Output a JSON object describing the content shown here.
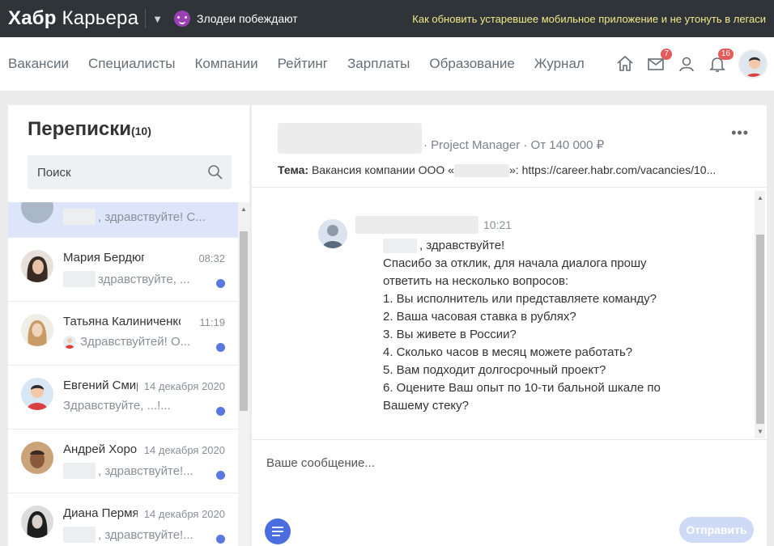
{
  "topbar": {
    "logo_bold": "Хабр",
    "logo_rest": "Карьера",
    "tagline": "Злодеи побеждают",
    "promo": "Как обновить устаревшее мобильное приложение и не утонуть в легаси"
  },
  "nav": {
    "items": [
      "Вакансии",
      "Специалисты",
      "Компании",
      "Рейтинг",
      "Зарплаты",
      "Образование",
      "Журнал"
    ],
    "messages_badge": "7",
    "notifications_badge": "16"
  },
  "conversations": {
    "title": "Переписки",
    "count": "(10)",
    "search_placeholder": "Поиск",
    "items": [
      {
        "name": "",
        "time": "",
        "preview": ", здравствуйте! С..."
      },
      {
        "name": "Мария Бердюгина",
        "time": "08:32",
        "preview": "здравствуйте, ..."
      },
      {
        "name": "Татьяна Калиниченко",
        "time": "11:19",
        "preview": "Здравствуйтей! О..."
      },
      {
        "name": "Евгений Смирнов",
        "time": "14 декабря 2020",
        "preview": "Здравствуйте, ...!..."
      },
      {
        "name": "Андрей Хорошилов",
        "time": "14 декабря 2020",
        "preview": ", здравствуйте!..."
      },
      {
        "name": "Диана Пермякова",
        "time": "14 декабря 2020",
        "preview": ", здравствуйте!..."
      }
    ]
  },
  "chat": {
    "contact_meta": "· Project Manager · От 140 000 ₽",
    "subject_label": "Тема:",
    "subject_prefix": "Вакансия компании ООО «",
    "subject_suffix": "»: https://career.habr.com/vacancies/10...",
    "message": {
      "time": "10:21",
      "lines": [
        ", здравствуйте!",
        "Спасибо за отклик, для начала диалога прошу",
        "ответить на несколько вопросов:",
        "1. Вы исполнитель или представляете команду?",
        "2. Ваша часовая ставка в рублях?",
        "3. Вы живете в России?",
        "4. Сколько часов в месяц можете работать?",
        "5. Вам подходит долгосрочный проект?",
        "6. Оцените Ваш опыт по 10-ти бальной шкале по",
        "Вашему стеку?"
      ]
    },
    "compose_placeholder": "Ваше сообщение...",
    "send_label": "Отправить"
  }
}
